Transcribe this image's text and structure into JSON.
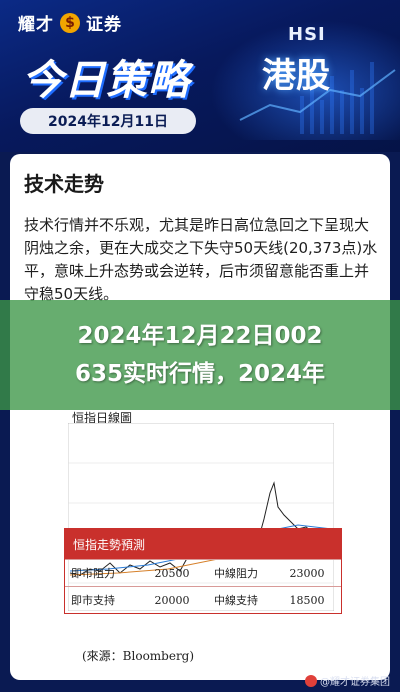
{
  "header": {
    "brand": "耀才",
    "brand_suffix": "证券",
    "headline": "今日策略",
    "date": "2024年12月11日",
    "tag_en": "HSI",
    "tag_cn": "港股"
  },
  "article": {
    "section_title": "技术走势",
    "paragraph": "技术行情并不乐观，尤其是昨日高位急回之下呈现大阴烛之余，更在大成交之下失守50天线(20,373点)水平，意味上升态势或会逆转，后市须留意能否重上并守稳50天线。"
  },
  "overlay": {
    "line1": "2024年12月22日002",
    "line2": "635实时行情，2024年"
  },
  "chart": {
    "title": "恒指日線圖",
    "source": "(來源：Bloomberg)"
  },
  "forecast": {
    "header": "恒指走勢預測",
    "rows": [
      {
        "label_a": "即市阻力",
        "value_a": "20500",
        "label_b": "中線阻力",
        "value_b": "23000"
      },
      {
        "label_a": "即市支持",
        "value_a": "20000",
        "label_b": "中線支持",
        "value_b": "18500"
      }
    ]
  },
  "watermark": {
    "text": "@耀才证券集团"
  }
}
